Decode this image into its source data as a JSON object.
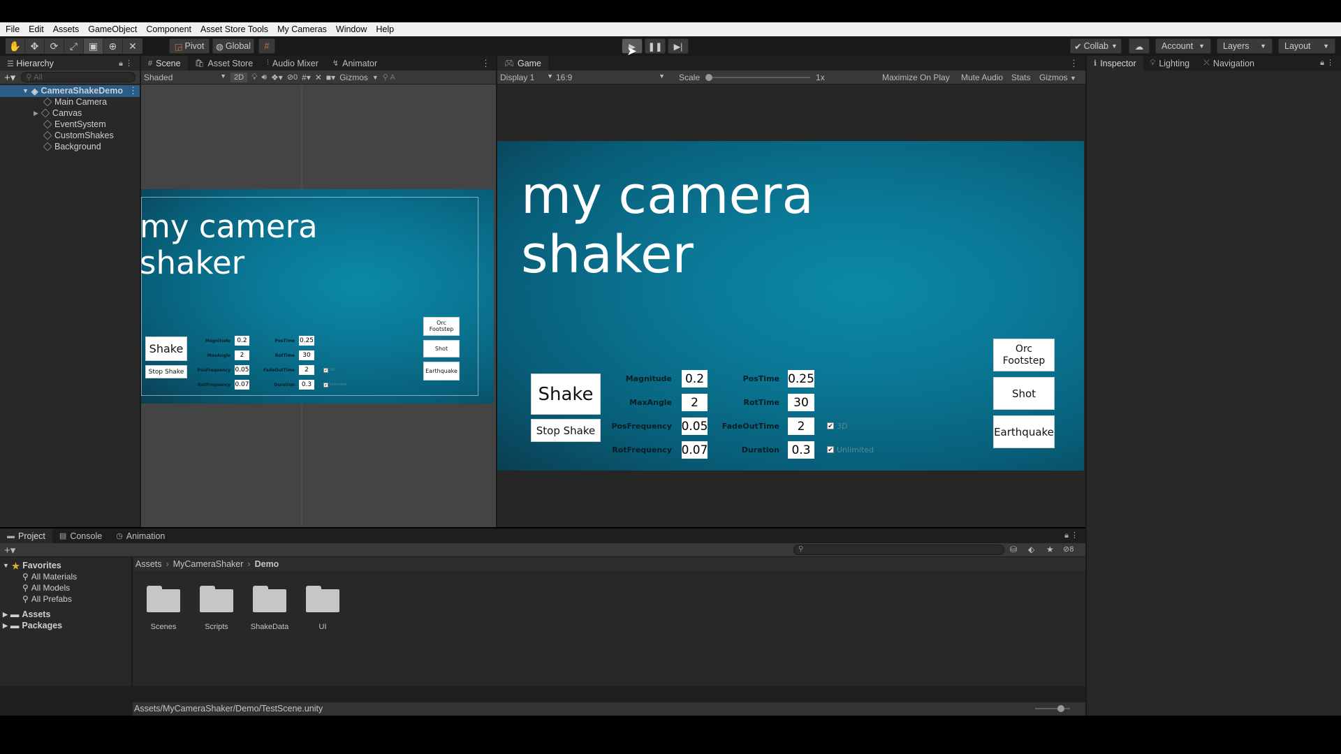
{
  "menu": [
    "File",
    "Edit",
    "Assets",
    "GameObject",
    "Component",
    "Asset Store Tools",
    "My Cameras",
    "Window",
    "Help"
  ],
  "toolbar": {
    "pivot": "Pivot",
    "global": "Global",
    "collab": "Collab",
    "account": "Account",
    "layers": "Layers",
    "layout": "Layout"
  },
  "hierarchy": {
    "tab": "Hierarchy",
    "search_placeholder": "All",
    "scene": "CameraShakeDemo",
    "items": [
      "Main Camera",
      "Canvas",
      "EventSystem",
      "CustomShakes",
      "Background"
    ]
  },
  "scene_view": {
    "tabs": [
      "Scene",
      "Asset Store",
      "Audio Mixer",
      "Animator"
    ],
    "shading": "Shaded",
    "mode_2d": "2D",
    "hidden_count": "0",
    "gizmos": "Gizmos",
    "search": "A"
  },
  "game_view": {
    "tab": "Game",
    "display": "Display 1",
    "aspect": "16:9",
    "scale_label": "Scale",
    "scale_value": "1x",
    "maximize": "Maximize On Play",
    "mute": "Mute Audio",
    "stats": "Stats",
    "gizmos": "Gizmos"
  },
  "game_ui": {
    "title_line1": "my camera",
    "title_line2": "shaker",
    "shake": "Shake",
    "stop_shake": "Stop Shake",
    "labels_left": [
      "Magnitude",
      "MaxAngle",
      "PosFrequency",
      "RotFrequency"
    ],
    "values_left": [
      "0.2",
      "2",
      "0.05",
      "0.07"
    ],
    "labels_right": [
      "PosTime",
      "RotTime",
      "FadeOutTime",
      "Duration"
    ],
    "values_right": [
      "0.25",
      "30",
      "2",
      "0.3"
    ],
    "check_3d": "3D",
    "check_unlimited": "Unlimited",
    "orc": "Orc Footstep",
    "shot": "Shot",
    "earthquake": "Earthquake"
  },
  "inspector": {
    "tabs": [
      "Inspector",
      "Lighting",
      "Navigation"
    ]
  },
  "project": {
    "tabs": [
      "Project",
      "Console",
      "Animation"
    ],
    "hidden_count": "8",
    "favorites": "Favorites",
    "fav_items": [
      "All Materials",
      "All Models",
      "All Prefabs"
    ],
    "roots": [
      "Assets",
      "Packages"
    ],
    "breadcrumb": [
      "Assets",
      "MyCameraShaker",
      "Demo"
    ],
    "folders": [
      "Scenes",
      "Scripts",
      "ShakeData",
      "UI"
    ],
    "status_path": "Assets/MyCameraShaker/Demo/TestScene.unity"
  },
  "colors": {
    "editor_bg": "#282828",
    "game_teal": "#0a7896"
  }
}
